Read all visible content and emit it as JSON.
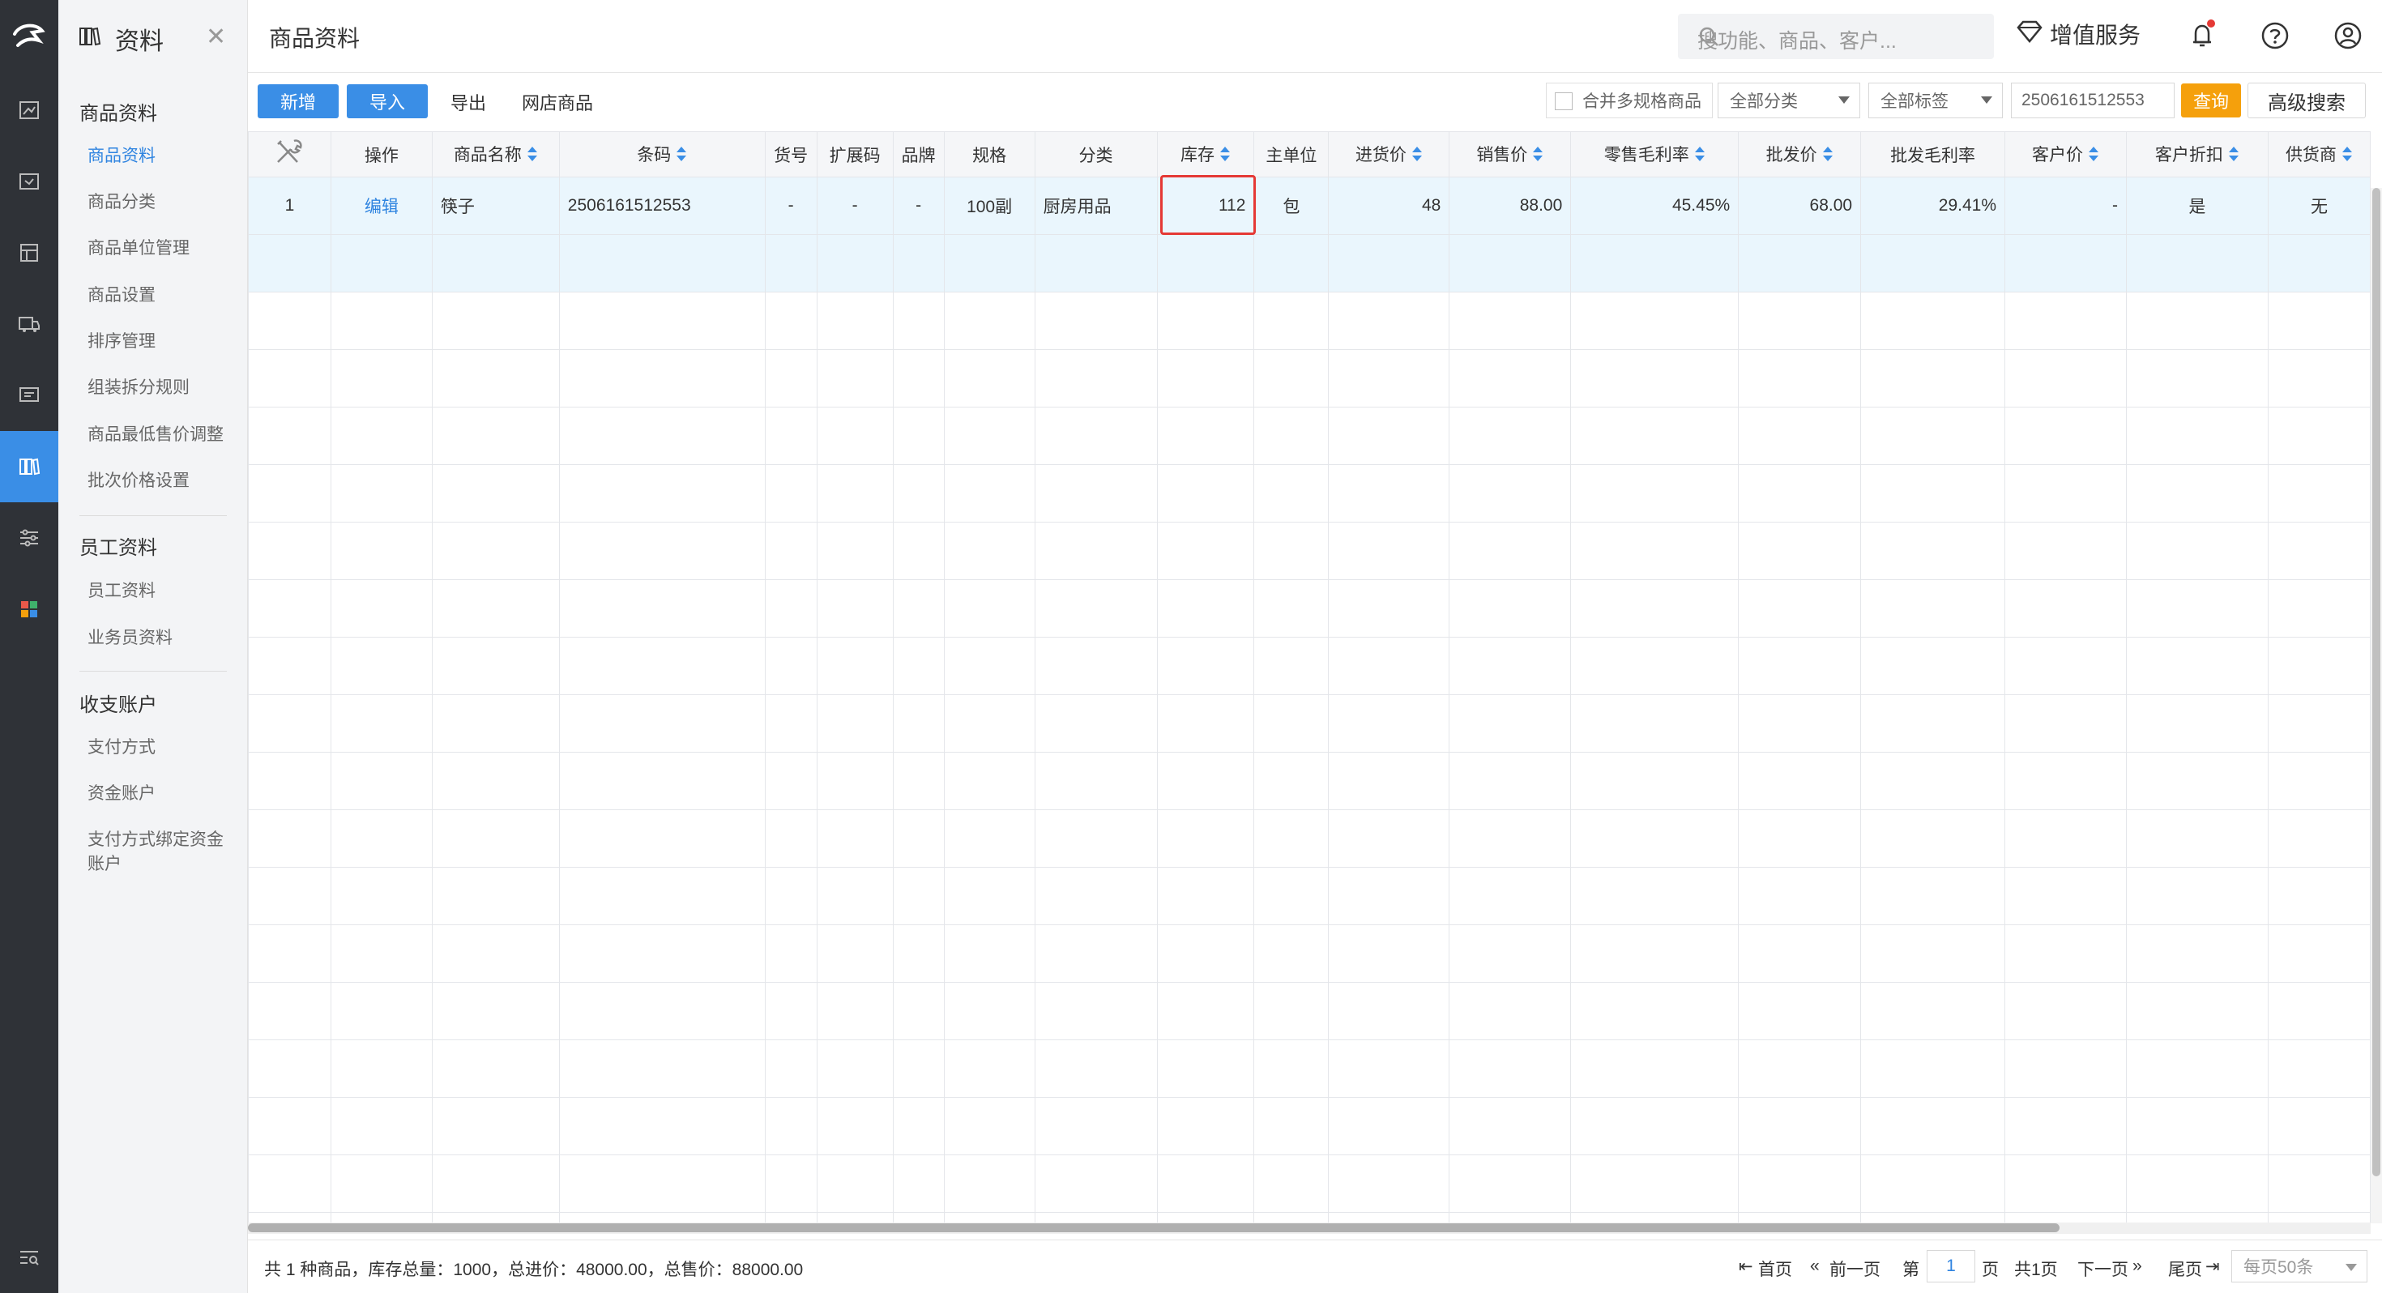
{
  "sidebar": {
    "title": "资料",
    "groups": [
      {
        "label": "商品资料",
        "items": [
          "商品资料",
          "商品分类",
          "商品单位管理",
          "商品设置",
          "排序管理",
          "组装拆分规则",
          "商品最低售价调整",
          "批次价格设置"
        ]
      },
      {
        "label": "员工资料",
        "items": [
          "员工资料",
          "业务员资料"
        ]
      },
      {
        "label": "收支账户",
        "items": [
          "支付方式",
          "资金账户",
          "支付方式绑定资金账户"
        ]
      }
    ]
  },
  "header": {
    "title": "商品资料",
    "search_placeholder": "搜功能、商品、客户...",
    "value_added": "增值服务"
  },
  "toolbar": {
    "add": "新增",
    "import": "导入",
    "export": "导出",
    "online_store": "网店商品",
    "merge_multi_spec": "合并多规格商品",
    "category_select": "全部分类",
    "tag_select": "全部标签",
    "search_value": "2506161512553",
    "query": "查询",
    "advanced_search": "高级搜索"
  },
  "table": {
    "columns": [
      "",
      "操作",
      "商品名称",
      "条码",
      "货号",
      "扩展码",
      "品牌",
      "规格",
      "分类",
      "库存",
      "主单位",
      "进货价",
      "销售价",
      "零售毛利率",
      "批发价",
      "批发毛利率",
      "客户价",
      "客户折扣",
      "供货商"
    ],
    "rows": [
      {
        "no": "1",
        "action": "编辑",
        "name": "筷子",
        "barcode": "2506161512553",
        "item_no": "-",
        "ext_code": "-",
        "brand": "-",
        "spec": "100副",
        "category": "厨房用品",
        "stock": "112",
        "unit": "包",
        "purchase_price": "48",
        "sale_price": "88.00",
        "retail_margin": "45.45%",
        "wholesale_price": "68.00",
        "wholesale_margin": "29.41%",
        "customer_price": "-",
        "customer_discount": "是",
        "supplier": "无"
      }
    ]
  },
  "footer": {
    "summary": "共 1 种商品，库存总量：1000，总进价：48000.00，总售价：88000.00",
    "first": "首页",
    "prev": "前一页",
    "page_prefix": "第",
    "page": "1",
    "page_suffix": "页",
    "total_pages": "共1页",
    "next": "下一页",
    "last": "尾页",
    "page_size": "每页50条"
  },
  "colors": {
    "accent": "#3a8ee6",
    "query": "#f5a00c",
    "highlight": "#e53935",
    "rail": "#2f3237"
  }
}
